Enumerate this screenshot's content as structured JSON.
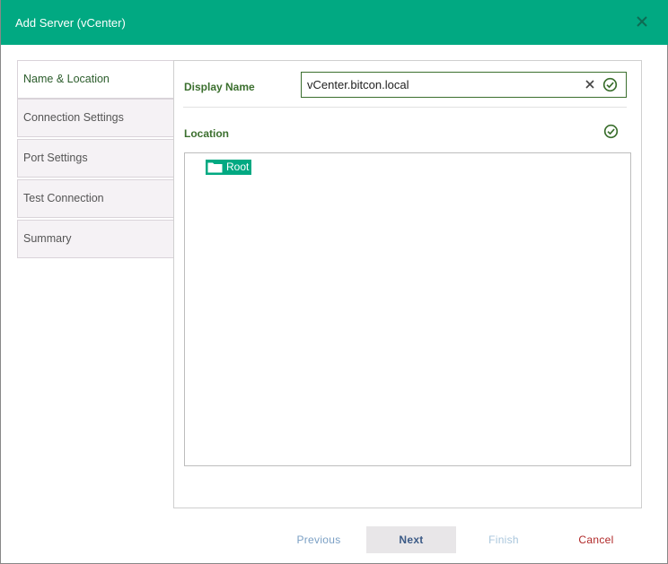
{
  "dialog": {
    "title": "Add Server (vCenter)"
  },
  "nav": {
    "items": [
      {
        "label": "Name & Location"
      },
      {
        "label": "Connection Settings"
      },
      {
        "label": "Port Settings"
      },
      {
        "label": "Test Connection"
      },
      {
        "label": "Summary"
      }
    ]
  },
  "form": {
    "display_name_label": "Display Name",
    "display_name_value": "vCenter.bitcon.local",
    "location_label": "Location",
    "tree_root": "Root"
  },
  "footer": {
    "previous_label": "Previous",
    "next_label": "Next",
    "finish_label": "Finish",
    "cancel_label": "Cancel"
  },
  "colors": {
    "accent": "#01a982",
    "label_green": "#3b6f2e",
    "cancel_red": "#b02828"
  }
}
